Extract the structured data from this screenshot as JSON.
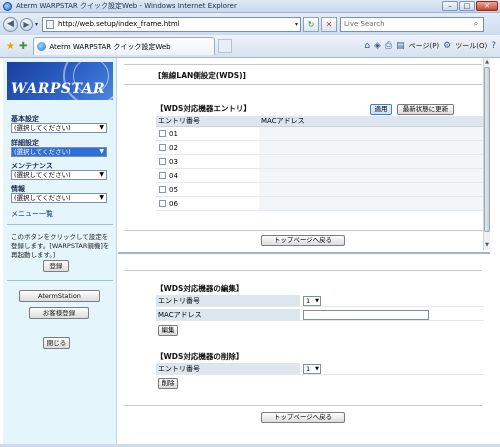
{
  "window": {
    "title": "Aterm WARPSTAR クイック設定Web - Windows Internet Explorer",
    "minimize": "–",
    "maximize": "□",
    "close": "✕"
  },
  "address": {
    "url": "http://web.setup/index_frame.html",
    "search_placeholder": "Live Search"
  },
  "tab": {
    "title": "Aterm WARPSTAR クイック設定Web"
  },
  "commands": {
    "page_label": "ページ(P)",
    "tools_label": "ツール(O)"
  },
  "sidebar": {
    "logo_text": "WARPSTAR",
    "groups": [
      {
        "heading": "基本設定",
        "selected": "(選択してください)"
      },
      {
        "heading": "詳細設定",
        "selected": "(選択してください)"
      },
      {
        "heading": "メンテナンス",
        "selected": "(選択してください)"
      },
      {
        "heading": "情報",
        "selected": "(選択してください)"
      }
    ],
    "menu_list_link": "メニュー一覧",
    "note": "このボタンをクリックして設定を登録します。[WARPSTAR親機]を再起動します。]",
    "register_button": "登録",
    "aterm_station_button": "AtermStation",
    "customer_register_button": "お客様登録",
    "close_button": "閉じる"
  },
  "main": {
    "page_title": "[無線LAN側設定(WDS)]",
    "entry_section_title": "【WDS対応機器エントリ】",
    "apply_button": "適用",
    "refresh_button": "最新状態に更新",
    "table_headers": [
      "エントリ番号",
      "MACアドレス"
    ],
    "entries": [
      "01",
      "02",
      "03",
      "04",
      "05",
      "06"
    ],
    "top_page_button": "トップページへ戻る",
    "edit_section_title": "【WDS対応機器の編集】",
    "edit_entry_label": "エントリ番号",
    "edit_entry_value": "1",
    "edit_mac_label": "MACアドレス",
    "edit_mac_value": "",
    "edit_button": "編集",
    "delete_section_title": "【WDS対応機器の削除】",
    "delete_entry_label": "エントリ番号",
    "delete_entry_value": "1",
    "delete_button": "削除",
    "top_page_button_2": "トップページへ戻る"
  }
}
